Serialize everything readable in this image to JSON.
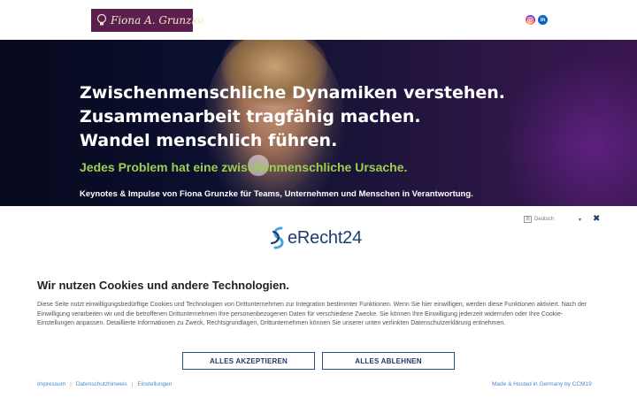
{
  "header": {
    "logo_text": "Fiona A. Grunzke",
    "social": [
      {
        "name": "instagram",
        "icon": "instagram-icon",
        "color": "#d6249f"
      },
      {
        "name": "linkedin",
        "icon": "linkedin-icon",
        "label": "in",
        "color": "#0a66c2"
      }
    ]
  },
  "hero": {
    "headline_1": "Zwischenmenschliche Dynamiken verstehen.",
    "headline_2": "Zusammenarbeit tragfähig machen.",
    "headline_3": "Wandel menschlich führen.",
    "tagline": "Jedes Problem hat eine zwischenmenschliche Ursache.",
    "subline": "Keynotes & Impulse von Fiona Grunzke für Teams, Unternehmen und Menschen in Verantwortung.",
    "tagline_color": "#9ccf4f"
  },
  "cookie": {
    "language": "Deutsch",
    "close_icon": "close-icon",
    "brand": "eRecht24",
    "title": "Wir nutzen Cookies und andere Technologien.",
    "body": "Diese Seite nutzt einwilligungsbedürftige Cookies und Technologien von Drittunternehmen zur Integration bestimmter Funktionen. Wenn Sie hier einwilligen, werden diese Funktionen aktiviert. Nach der Einwilligung verarbeiten wir und die betroffenen Drittunternehmen Ihre personenbezogenen Daten für verschiedene Zwecke. Sie können Ihre Einwilligung jederzeit widerrufen oder Ihre Cookie-Einstellungen anpassen. Detaillierte Informationen zu Zweck, Rechtsgrundlagen, Drittunternehmen können Sie unserer unten verlinkten Datenschutzerklärung entnehmen.",
    "accept_label": "ALLES AKZEPTIEREN",
    "reject_label": "ALLES ABLEHNEN",
    "links": [
      "Impressum",
      "Datenschutzhinweis",
      "Einstellungen"
    ],
    "made_hosted": "Made & Hosted in Germany by CCM19",
    "accent_color": "#1d3b6b"
  }
}
